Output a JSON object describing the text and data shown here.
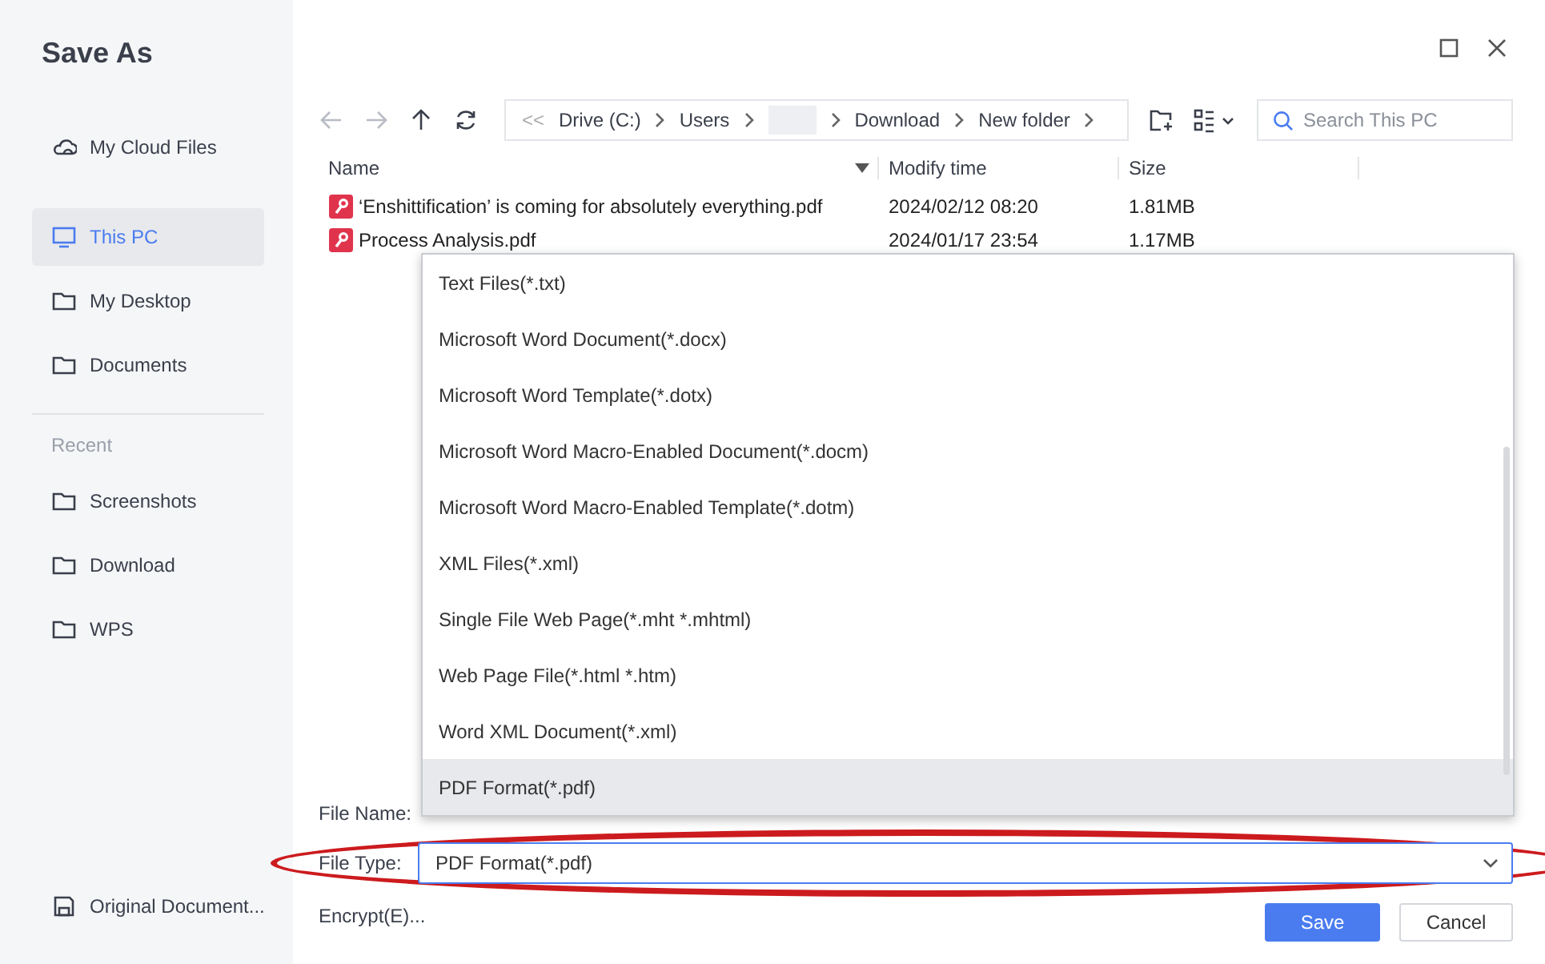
{
  "window": {
    "title": "Save As",
    "controls": [
      {
        "kind": "maximize"
      },
      {
        "kind": "close"
      }
    ]
  },
  "sidebar": {
    "items": [
      {
        "label": "My Cloud Files",
        "selected": false
      },
      {
        "label": "This PC",
        "selected": true
      },
      {
        "label": "My Desktop",
        "selected": false
      },
      {
        "label": "Documents",
        "selected": false
      }
    ],
    "recent_heading": "Recent",
    "recent": [
      {
        "label": "Screenshots",
        "selected": false
      },
      {
        "label": "Download",
        "selected": false
      },
      {
        "label": "WPS",
        "selected": false
      }
    ],
    "bottom_item": {
      "label": "Original Document..."
    }
  },
  "toolbar": {
    "back_disabled": true,
    "forward_disabled": true,
    "breadcrumb_overflow": "<<",
    "breadcrumb": [
      {
        "label": "Drive (C:)",
        "kind": "text"
      },
      {
        "label": "Users",
        "kind": "text"
      },
      {
        "kind": "redacted"
      },
      {
        "label": "Download",
        "kind": "text"
      },
      {
        "label": "New folder",
        "kind": "text"
      }
    ],
    "search": {
      "placeholder": "Search This PC"
    }
  },
  "table": {
    "columns": [
      "Name",
      "Modify time",
      "Size"
    ],
    "rows": [
      {
        "name": "‘Enshittification’ is coming for absolutely everything.pdf",
        "modified": "2024/02/12 08:20",
        "size": "1.81MB"
      },
      {
        "name": "Process Analysis.pdf",
        "modified": "2024/01/17 23:54",
        "size": "1.17MB"
      }
    ]
  },
  "file_type_menu": {
    "options": [
      {
        "label": "Text Files(*.txt)",
        "selected": false
      },
      {
        "label": "Microsoft Word Document(*.docx)",
        "selected": false
      },
      {
        "label": "Microsoft Word Template(*.dotx)",
        "selected": false
      },
      {
        "label": "Microsoft Word Macro-Enabled Document(*.docm)",
        "selected": false
      },
      {
        "label": "Microsoft Word Macro-Enabled Template(*.dotm)",
        "selected": false
      },
      {
        "label": "XML Files(*.xml)",
        "selected": false
      },
      {
        "label": "Single File Web Page(*.mht *.mhtml)",
        "selected": false
      },
      {
        "label": "Web Page File(*.html *.htm)",
        "selected": false
      },
      {
        "label": "Word XML Document(*.xml)",
        "selected": false
      },
      {
        "label": "PDF Format(*.pdf)",
        "selected": true
      }
    ]
  },
  "form": {
    "file_name_label": "File Name:",
    "file_type_label": "File Type:",
    "file_type_value": "PDF Format(*.pdf)",
    "file_type_highlighted": true,
    "encrypt_link": "Encrypt(E)..."
  },
  "buttons": [
    {
      "label": "Save",
      "kind": "primary"
    },
    {
      "label": "Cancel",
      "kind": "secondary"
    }
  ]
}
